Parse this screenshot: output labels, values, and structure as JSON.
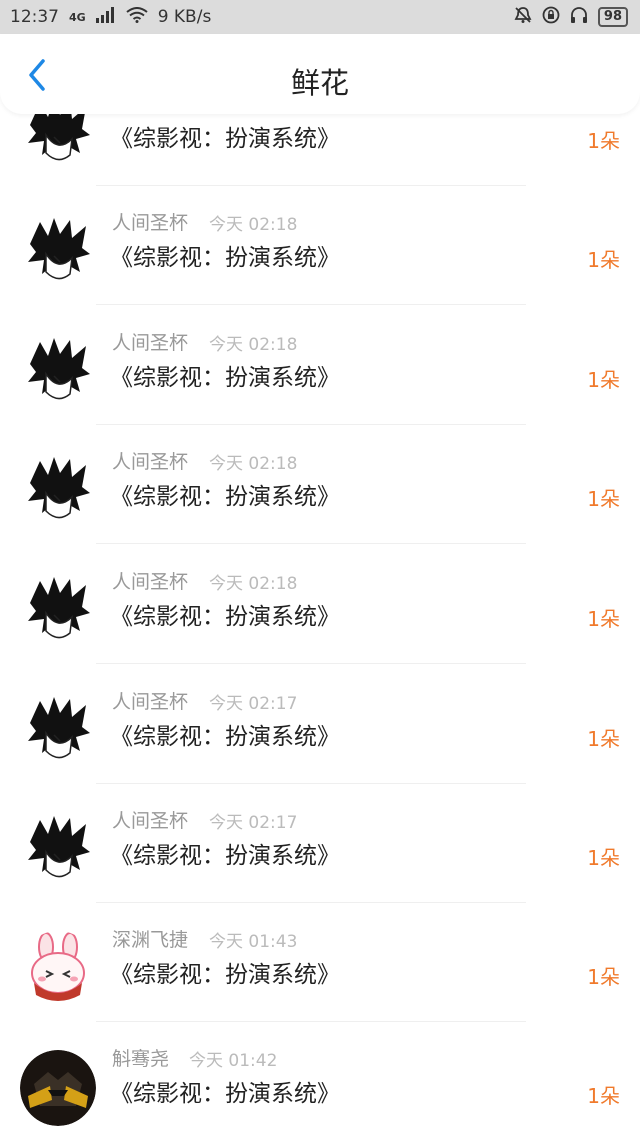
{
  "status": {
    "time": "12:37",
    "net": "4G",
    "speed": "9 KB/s",
    "battery": "98"
  },
  "header": {
    "title": "鲜花"
  },
  "rows": [
    {
      "name": "",
      "time": "",
      "book": "《综影视：扮演系统》",
      "amount": "1朵",
      "avatar": "manga"
    },
    {
      "name": "人间圣杯",
      "time": "今天 02:18",
      "book": "《综影视：扮演系统》",
      "amount": "1朵",
      "avatar": "manga"
    },
    {
      "name": "人间圣杯",
      "time": "今天 02:18",
      "book": "《综影视：扮演系统》",
      "amount": "1朵",
      "avatar": "manga"
    },
    {
      "name": "人间圣杯",
      "time": "今天 02:18",
      "book": "《综影视：扮演系统》",
      "amount": "1朵",
      "avatar": "manga"
    },
    {
      "name": "人间圣杯",
      "time": "今天 02:18",
      "book": "《综影视：扮演系统》",
      "amount": "1朵",
      "avatar": "manga"
    },
    {
      "name": "人间圣杯",
      "time": "今天 02:17",
      "book": "《综影视：扮演系统》",
      "amount": "1朵",
      "avatar": "manga"
    },
    {
      "name": "人间圣杯",
      "time": "今天 02:17",
      "book": "《综影视：扮演系统》",
      "amount": "1朵",
      "avatar": "manga"
    },
    {
      "name": "深渊飞捷",
      "time": "今天 01:43",
      "book": "《综影视：扮演系统》",
      "amount": "1朵",
      "avatar": "bunny"
    },
    {
      "name": "斛骞尧",
      "time": "今天 01:42",
      "book": "《综影视：扮演系统》",
      "amount": "1朵",
      "avatar": "dark"
    }
  ],
  "colors": {
    "accent": "#1e88e5",
    "amount": "#f07a2c"
  }
}
